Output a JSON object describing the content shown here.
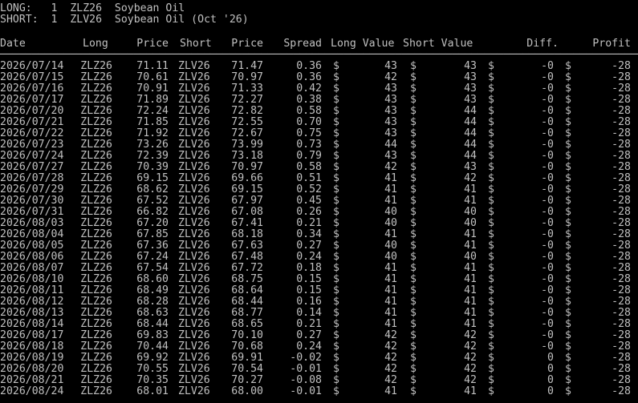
{
  "header": {
    "long_line": "LONG:   1  ZLZ26  Soybean Oil",
    "short_line": "SHORT:  1  ZLV26  Soybean Oil (Oct '26)"
  },
  "table": {
    "columns": [
      "Date",
      "Long",
      "Price",
      "Short",
      "Price",
      "Spread",
      "Long Value",
      "Short Value",
      "Diff.",
      "Profit"
    ],
    "currency_symbol": "$",
    "rows": [
      [
        "2026/07/14",
        "ZLZ26",
        "71.11",
        "ZLV26",
        "71.47",
        "0.36",
        "43",
        "43",
        "-0",
        "-28"
      ],
      [
        "2026/07/15",
        "ZLZ26",
        "70.61",
        "ZLV26",
        "70.97",
        "0.36",
        "42",
        "43",
        "-0",
        "-28"
      ],
      [
        "2026/07/16",
        "ZLZ26",
        "70.91",
        "ZLV26",
        "71.33",
        "0.42",
        "43",
        "43",
        "-0",
        "-28"
      ],
      [
        "2026/07/17",
        "ZLZ26",
        "71.89",
        "ZLV26",
        "72.27",
        "0.38",
        "43",
        "43",
        "-0",
        "-28"
      ],
      [
        "2026/07/20",
        "ZLZ26",
        "72.24",
        "ZLV26",
        "72.82",
        "0.58",
        "43",
        "44",
        "-0",
        "-28"
      ],
      [
        "2026/07/21",
        "ZLZ26",
        "71.85",
        "ZLV26",
        "72.55",
        "0.70",
        "43",
        "44",
        "-0",
        "-28"
      ],
      [
        "2026/07/22",
        "ZLZ26",
        "71.92",
        "ZLV26",
        "72.67",
        "0.75",
        "43",
        "44",
        "-0",
        "-28"
      ],
      [
        "2026/07/23",
        "ZLZ26",
        "73.26",
        "ZLV26",
        "73.99",
        "0.73",
        "44",
        "44",
        "-0",
        "-28"
      ],
      [
        "2026/07/24",
        "ZLZ26",
        "72.39",
        "ZLV26",
        "73.18",
        "0.79",
        "43",
        "44",
        "-0",
        "-28"
      ],
      [
        "2026/07/27",
        "ZLZ26",
        "70.39",
        "ZLV26",
        "70.97",
        "0.58",
        "42",
        "43",
        "-0",
        "-28"
      ],
      [
        "2026/07/28",
        "ZLZ26",
        "69.15",
        "ZLV26",
        "69.66",
        "0.51",
        "41",
        "42",
        "-0",
        "-28"
      ],
      [
        "2026/07/29",
        "ZLZ26",
        "68.62",
        "ZLV26",
        "69.15",
        "0.52",
        "41",
        "41",
        "-0",
        "-28"
      ],
      [
        "2026/07/30",
        "ZLZ26",
        "67.52",
        "ZLV26",
        "67.97",
        "0.45",
        "41",
        "41",
        "-0",
        "-28"
      ],
      [
        "2026/07/31",
        "ZLZ26",
        "66.82",
        "ZLV26",
        "67.08",
        "0.26",
        "40",
        "40",
        "-0",
        "-28"
      ],
      [
        "2026/08/03",
        "ZLZ26",
        "67.20",
        "ZLV26",
        "67.41",
        "0.21",
        "40",
        "40",
        "-0",
        "-28"
      ],
      [
        "2026/08/04",
        "ZLZ26",
        "67.85",
        "ZLV26",
        "68.18",
        "0.34",
        "41",
        "41",
        "-0",
        "-28"
      ],
      [
        "2026/08/05",
        "ZLZ26",
        "67.36",
        "ZLV26",
        "67.63",
        "0.27",
        "40",
        "41",
        "-0",
        "-28"
      ],
      [
        "2026/08/06",
        "ZLZ26",
        "67.24",
        "ZLV26",
        "67.48",
        "0.24",
        "40",
        "40",
        "-0",
        "-28"
      ],
      [
        "2026/08/07",
        "ZLZ26",
        "67.54",
        "ZLV26",
        "67.72",
        "0.18",
        "41",
        "41",
        "-0",
        "-28"
      ],
      [
        "2026/08/10",
        "ZLZ26",
        "68.60",
        "ZLV26",
        "68.75",
        "0.15",
        "41",
        "41",
        "-0",
        "-28"
      ],
      [
        "2026/08/11",
        "ZLZ26",
        "68.49",
        "ZLV26",
        "68.64",
        "0.15",
        "41",
        "41",
        "-0",
        "-28"
      ],
      [
        "2026/08/12",
        "ZLZ26",
        "68.28",
        "ZLV26",
        "68.44",
        "0.16",
        "41",
        "41",
        "-0",
        "-28"
      ],
      [
        "2026/08/13",
        "ZLZ26",
        "68.63",
        "ZLV26",
        "68.77",
        "0.14",
        "41",
        "41",
        "-0",
        "-28"
      ],
      [
        "2026/08/14",
        "ZLZ26",
        "68.44",
        "ZLV26",
        "68.65",
        "0.21",
        "41",
        "41",
        "-0",
        "-28"
      ],
      [
        "2026/08/17",
        "ZLZ26",
        "69.83",
        "ZLV26",
        "70.10",
        "0.27",
        "42",
        "42",
        "-0",
        "-28"
      ],
      [
        "2026/08/18",
        "ZLZ26",
        "70.44",
        "ZLV26",
        "70.68",
        "0.24",
        "42",
        "42",
        "-0",
        "-28"
      ],
      [
        "2026/08/19",
        "ZLZ26",
        "69.92",
        "ZLV26",
        "69.91",
        "-0.02",
        "42",
        "42",
        "0",
        "-28"
      ],
      [
        "2026/08/20",
        "ZLZ26",
        "70.55",
        "ZLV26",
        "70.54",
        "-0.01",
        "42",
        "42",
        "0",
        "-28"
      ],
      [
        "2026/08/21",
        "ZLZ26",
        "70.35",
        "ZLV26",
        "70.27",
        "-0.08",
        "42",
        "42",
        "0",
        "-28"
      ],
      [
        "2026/08/24",
        "ZLZ26",
        "68.01",
        "ZLV26",
        "68.00",
        "-0.01",
        "41",
        "41",
        "0",
        "-28"
      ]
    ]
  }
}
